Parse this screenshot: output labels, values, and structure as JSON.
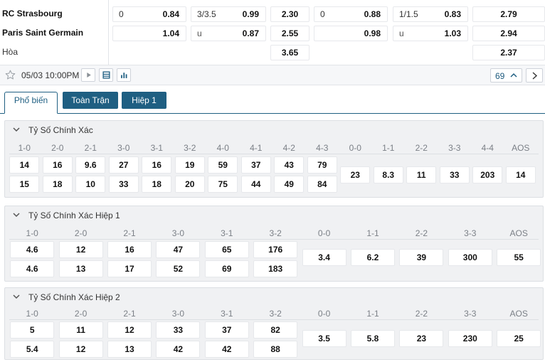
{
  "odds": {
    "home_team": "RC Strasbourg",
    "away_team": "Paris Saint Germain",
    "draw_label": "Hòa",
    "row1": {
      "hcap_line": "0",
      "hcap_home": "0.84",
      "ou_line": "3/3.5",
      "ou_over": "0.99",
      "x12_home": "2.30",
      "h1_hcap_line": "0",
      "h1_hcap_home": "0.88",
      "h1_ou_line": "1/1.5",
      "h1_ou_over": "0.83",
      "h1_x12_home": "2.79"
    },
    "row2": {
      "hcap_away": "1.04",
      "ou_under_label": "u",
      "ou_under": "0.87",
      "x12_away": "2.55",
      "h1_hcap_away": "0.98",
      "h1_ou_under_label": "u",
      "h1_ou_under": "1.03",
      "h1_x12_away": "2.94"
    },
    "row3": {
      "x12_draw": "3.65",
      "h1_x12_draw": "2.37"
    }
  },
  "info": {
    "datetime": "05/03 10:00PM",
    "more_count": "69"
  },
  "tabs": [
    {
      "label": "Phổ biến"
    },
    {
      "label": "Toàn Trận"
    },
    {
      "label": "Hiệp 1"
    }
  ],
  "sections": [
    {
      "title": "Tỷ Số Chính Xác",
      "columns": [
        "1-0",
        "2-0",
        "2-1",
        "3-0",
        "3-1",
        "3-2",
        "4-0",
        "4-1",
        "4-2",
        "4-3",
        "0-0",
        "1-1",
        "2-2",
        "3-3",
        "4-4",
        "AOS"
      ],
      "home_row": [
        "14",
        "16",
        "9.6",
        "27",
        "16",
        "19",
        "59",
        "37",
        "43",
        "79"
      ],
      "away_row": [
        "15",
        "18",
        "10",
        "33",
        "18",
        "20",
        "75",
        "44",
        "49",
        "84"
      ],
      "draw_row": [
        "23",
        "8.3",
        "11",
        "33",
        "203",
        "14"
      ]
    },
    {
      "title": "Tỷ Số Chính Xác Hiệp 1",
      "columns": [
        "1-0",
        "2-0",
        "2-1",
        "3-0",
        "3-1",
        "3-2",
        "0-0",
        "1-1",
        "2-2",
        "3-3",
        "AOS"
      ],
      "home_row": [
        "4.6",
        "12",
        "16",
        "47",
        "65",
        "176"
      ],
      "away_row": [
        "4.6",
        "13",
        "17",
        "52",
        "69",
        "183"
      ],
      "draw_row": [
        "3.4",
        "6.2",
        "39",
        "300",
        "55"
      ]
    },
    {
      "title": "Tỷ Số Chính Xác Hiệp 2",
      "columns": [
        "1-0",
        "2-0",
        "2-1",
        "3-0",
        "3-1",
        "3-2",
        "0-0",
        "1-1",
        "2-2",
        "3-3",
        "AOS"
      ],
      "home_row": [
        "5",
        "11",
        "12",
        "33",
        "37",
        "82"
      ],
      "away_row": [
        "5.4",
        "12",
        "13",
        "42",
        "42",
        "88"
      ],
      "draw_row": [
        "3.5",
        "5.8",
        "23",
        "230",
        "25"
      ]
    }
  ]
}
